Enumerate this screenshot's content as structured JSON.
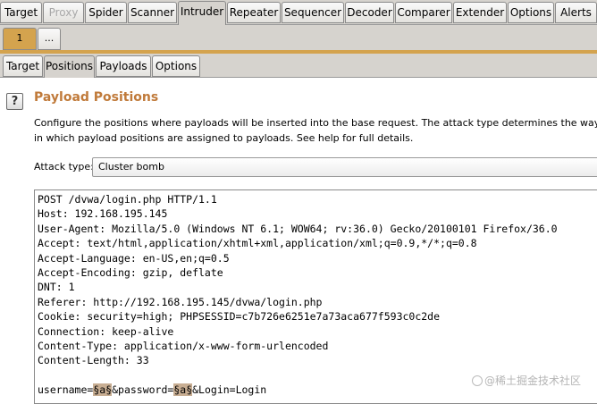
{
  "main_tabs": [
    "Target",
    "Proxy",
    "Spider",
    "Scanner",
    "Intruder",
    "Repeater",
    "Sequencer",
    "Decoder",
    "Comparer",
    "Extender",
    "Options",
    "Alerts"
  ],
  "active_main_tab": "Intruder",
  "dimmed_main_tab": "Proxy",
  "attack_tabs": [
    "1",
    "..."
  ],
  "sub_tabs": [
    "Target",
    "Positions",
    "Payloads",
    "Options"
  ],
  "active_sub_tab": "Positions",
  "help_icon": "?",
  "section": {
    "title": "Payload Positions",
    "description": "Configure the positions where payloads will be inserted into the base request. The attack type determines the way in which payload positions are assigned to payloads. See help for full details."
  },
  "attack_type": {
    "label": "Attack type:",
    "value": "Cluster bomb"
  },
  "request_lines": [
    "POST /dvwa/login.php HTTP/1.1",
    "Host: 192.168.195.145",
    "User-Agent: Mozilla/5.0 (Windows NT 6.1; WOW64; rv:36.0) Gecko/20100101 Firefox/36.0",
    "Accept: text/html,application/xhtml+xml,application/xml;q=0.9,*/*;q=0.8",
    "Accept-Language: en-US,en;q=0.5",
    "Accept-Encoding: gzip, deflate",
    "DNT: 1",
    "Referer: http://192.168.195.145/dvwa/login.php",
    "Cookie: security=high; PHPSESSID=c7b726e6251e7a73aca677f593c0c2de",
    "Connection: keep-alive",
    "Content-Type: application/x-www-form-urlencoded",
    "Content-Length: 33"
  ],
  "body_line": {
    "prefix": "username=",
    "marker1": "§a§",
    "middle": "&password=",
    "marker2": "§a§",
    "suffix": "&Login=Login"
  },
  "watermark": "@稀土掘金技术社区",
  "colors": {
    "accent_title": "#c07a3a",
    "attack_tab": "#d4a34e",
    "payload_marker": "#c8ae93"
  }
}
